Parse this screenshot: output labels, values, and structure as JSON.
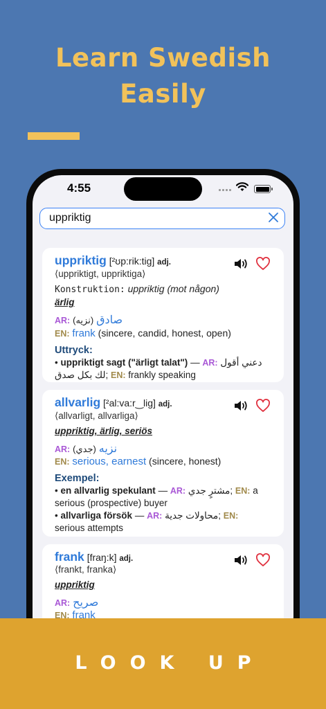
{
  "headline": {
    "line1": "Learn Swedish",
    "line2": "Easily"
  },
  "colors": {
    "background": "#4c77b1",
    "accent": "#f2c25a",
    "banner": "#dea32f",
    "headword": "#2f7ad9",
    "ar_tag": "#a958d6",
    "en_tag": "#a18a4b"
  },
  "status_bar": {
    "time": "4:55"
  },
  "search": {
    "value": "uppriktig",
    "clear_icon": "close-icon"
  },
  "entries": [
    {
      "headword": "uppriktig",
      "pron": "[²ʊp:rik:tig]",
      "pos": "adj.",
      "forms": "⟨uppriktigt, uppriktiga⟩",
      "construction_label": "Konstruktion:",
      "construction_value": "uppriktig (mot någon)",
      "synonyms": "ärlig",
      "ar_label": "AR:",
      "ar_small": "(نزيه)",
      "ar_main": "صادق",
      "en_label": "EN:",
      "en_main": "frank",
      "en_gloss": "(sincere, candid, honest, open)",
      "section_title": "Uttryck:",
      "examples": [
        {
          "bullet": "•",
          "sv": "uppriktigt sagt (\"ärligt talat\")",
          "dash": "—",
          "ar_label": "AR:",
          "ar": "دعني أقول",
          "line2_ar": "لك بكل صدق;",
          "en_label": "EN:",
          "en": "frankly speaking"
        }
      ]
    },
    {
      "headword": "allvarlig",
      "pron": "[²al:va:r‿lig]",
      "pos": "adj.",
      "forms": "⟨allvarligt, allvarliga⟩",
      "synonyms": "uppriktig, ärlig, seriös",
      "ar_label": "AR:",
      "ar_small": "(جدي)",
      "ar_main": "نزيه",
      "en_label": "EN:",
      "en_main": "serious, earnest",
      "en_gloss": "(sincere, honest)",
      "section_title": "Exempel:",
      "examples": [
        {
          "bullet": "•",
          "sv": "en allvarlig spekulant",
          "dash": "—",
          "ar_label": "AR:",
          "ar": "مشترٍ جدي;",
          "en_label": "EN:",
          "en": "a",
          "en_cont": "serious (prospective) buyer"
        },
        {
          "bullet": "•",
          "sv": "allvarliga försök",
          "dash": "—",
          "ar_label": "AR:",
          "ar": "محاولات جدية;",
          "en_label": "EN:",
          "en_cont": "serious attempts"
        }
      ]
    },
    {
      "headword": "frank",
      "pron": "[fraŋ:k]",
      "pos": "adj.",
      "forms": "⟨frankt, franka⟩",
      "synonyms": "uppriktig",
      "ar_label": "AR:",
      "ar_main": "صريح",
      "en_label": "EN:",
      "en_main": "frank"
    }
  ],
  "entry_icons": {
    "sound": "speaker-icon",
    "favorite": "heart-icon"
  },
  "banner": {
    "label": "LOOK UP"
  }
}
